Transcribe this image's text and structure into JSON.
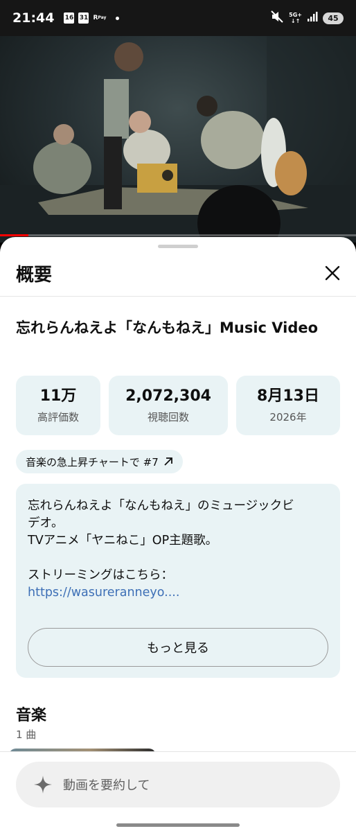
{
  "status_bar": {
    "time": "21:44",
    "cal_day_1": "16",
    "cal_day_2": "31",
    "pay_top": "R",
    "pay_bottom": "Pay",
    "network": "5G+",
    "battery": "45"
  },
  "player": {
    "progress_fraction": 0.08
  },
  "sheet": {
    "title": "概要",
    "video_title": "忘れらんねえよ「なんもねえ」Music Video",
    "stats": [
      {
        "value": "11万",
        "label": "高評価数"
      },
      {
        "value": "2,072,304",
        "label": "視聴回数"
      },
      {
        "value": "8月13日",
        "label": "2026年"
      }
    ],
    "chart_chip": "音楽の急上昇チャートで #7",
    "description": {
      "line1": "忘れらんねえよ「なんもねえ」のミュージックビ",
      "line2": "デオ。",
      "line3": "TVアニメ「ヤニねこ」OP主題歌。",
      "line4": "ストリーミングはこちら：",
      "link": "https://wasureranneyo...."
    },
    "more_button": "もっと見る",
    "music_heading": "音楽",
    "music_count": "1 曲"
  },
  "footer": {
    "summary_placeholder": "動画を要約して"
  },
  "colors": {
    "accent_red": "#ff0000",
    "chip_bg": "#e9f3f5",
    "link": "#3d6fb6"
  },
  "icons": [
    "calendar-icon",
    "rakuten-pay-icon",
    "mute-icon",
    "signal-icon",
    "battery-icon",
    "close-icon",
    "arrow-up-right-icon",
    "sparkle-icon"
  ]
}
